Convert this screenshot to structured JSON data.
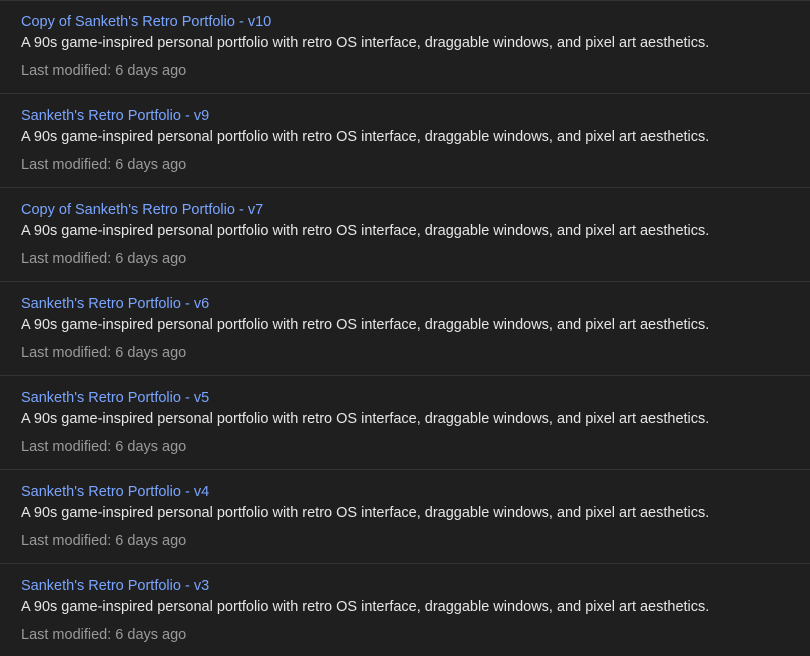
{
  "colors": {
    "background": "#1f1f1f",
    "divider": "#333333",
    "title_link": "#7aa5ff",
    "description": "#e6e6e6",
    "meta": "#9a9a9a"
  },
  "projects": [
    {
      "title": "Copy of Sanketh's Retro Portfolio - v10",
      "description": "A 90s game-inspired personal portfolio with retro OS interface, draggable windows, and pixel art aesthetics.",
      "modified": "Last modified: 6 days ago"
    },
    {
      "title": "Sanketh's Retro Portfolio - v9",
      "description": "A 90s game-inspired personal portfolio with retro OS interface, draggable windows, and pixel art aesthetics.",
      "modified": "Last modified: 6 days ago"
    },
    {
      "title": "Copy of Sanketh's Retro Portfolio - v7",
      "description": "A 90s game-inspired personal portfolio with retro OS interface, draggable windows, and pixel art aesthetics.",
      "modified": "Last modified: 6 days ago"
    },
    {
      "title": "Sanketh's Retro Portfolio - v6",
      "description": "A 90s game-inspired personal portfolio with retro OS interface, draggable windows, and pixel art aesthetics.",
      "modified": "Last modified: 6 days ago"
    },
    {
      "title": "Sanketh's Retro Portfolio - v5",
      "description": "A 90s game-inspired personal portfolio with retro OS interface, draggable windows, and pixel art aesthetics.",
      "modified": "Last modified: 6 days ago"
    },
    {
      "title": "Sanketh's Retro Portfolio - v4",
      "description": "A 90s game-inspired personal portfolio with retro OS interface, draggable windows, and pixel art aesthetics.",
      "modified": "Last modified: 6 days ago"
    },
    {
      "title": "Sanketh's Retro Portfolio - v3",
      "description": "A 90s game-inspired personal portfolio with retro OS interface, draggable windows, and pixel art aesthetics.",
      "modified": "Last modified: 6 days ago"
    }
  ]
}
